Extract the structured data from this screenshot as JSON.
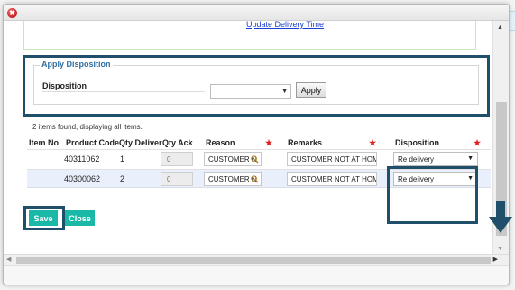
{
  "update_link": "Update Delivery Time",
  "disposition_panel": {
    "legend": "Apply Disposition",
    "label": "Disposition",
    "select_value": "",
    "apply_label": "Apply"
  },
  "found_text": "2 items found, displaying all items.",
  "table": {
    "headers": {
      "item_no": "Item No",
      "product_code": "Product Code",
      "qty_deliver": "Qty Deliver",
      "qty_ack": "Qty Ack",
      "reason": "Reason",
      "remarks": "Remarks",
      "disposition": "Disposition"
    },
    "required_mark": "★",
    "rows": [
      {
        "item_no": "",
        "product_code": "40311062",
        "qty_deliver": "1",
        "qty_ack": "0",
        "reason": "CUSTOMER N",
        "remarks": "CUSTOMER NOT AT HOM",
        "disposition": "Re delivery"
      },
      {
        "item_no": "",
        "product_code": "40300062",
        "qty_deliver": "2",
        "qty_ack": "0",
        "reason": "CUSTOMER N",
        "remarks": "CUSTOMER NOT AT HOM",
        "disposition": "Re delivery"
      }
    ]
  },
  "buttons": {
    "save": "Save",
    "close": "Close"
  },
  "colors": {
    "teal": "#19b8a7",
    "highlight": "#1f4f6b",
    "link": "#1a3fd1",
    "required": "#e02020"
  },
  "icons": {
    "close": "close-circle-icon",
    "lookup": "magnifier-icon",
    "dropdown": "triangle-down-icon",
    "annotation": "arrow-down-icon"
  }
}
